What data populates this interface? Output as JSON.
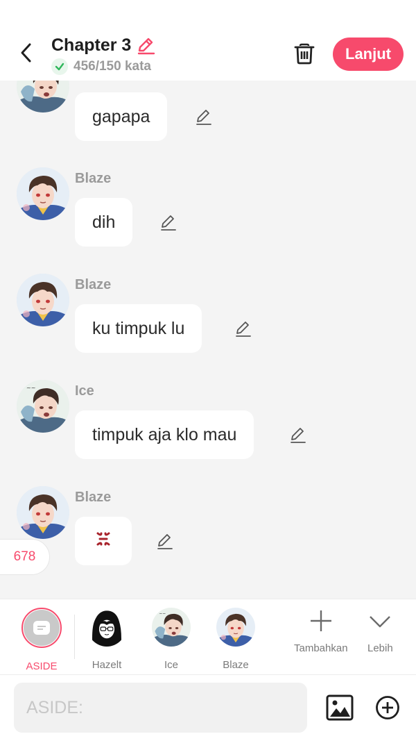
{
  "header": {
    "title": "Chapter 3",
    "word_count": "456/150 kata",
    "next_label": "Lanjut"
  },
  "messages": [
    {
      "speaker": "",
      "text": "gapapa",
      "avatar": "ice-avatar"
    },
    {
      "speaker": "Blaze",
      "text": "dih",
      "avatar": "blaze-avatar"
    },
    {
      "speaker": "Blaze",
      "text": "ku timpuk lu",
      "avatar": "blaze-avatar"
    },
    {
      "speaker": "Ice",
      "text": "timpuk aja klo mau",
      "avatar": "ice-avatar"
    },
    {
      "speaker": "Blaze",
      "text": "",
      "avatar": "blaze-avatar",
      "content_icon": "anger-symbol-icon"
    }
  ],
  "badge": {
    "count": "678"
  },
  "characters": [
    {
      "label": "ASIDE",
      "active": true
    },
    {
      "label": "Hazelt",
      "active": false
    },
    {
      "label": "Ice",
      "active": false
    },
    {
      "label": "Blaze",
      "active": false
    }
  ],
  "tools": [
    {
      "label": "Tambahkan",
      "icon": "plus-icon"
    },
    {
      "label": "Lebih",
      "icon": "chevron-down-icon"
    }
  ],
  "input": {
    "placeholder": "ASIDE:"
  },
  "colors": {
    "accent": "#f74a6c",
    "background": "#f4f4f4",
    "success": "#2fb75b",
    "muted": "#9a9a9a"
  }
}
